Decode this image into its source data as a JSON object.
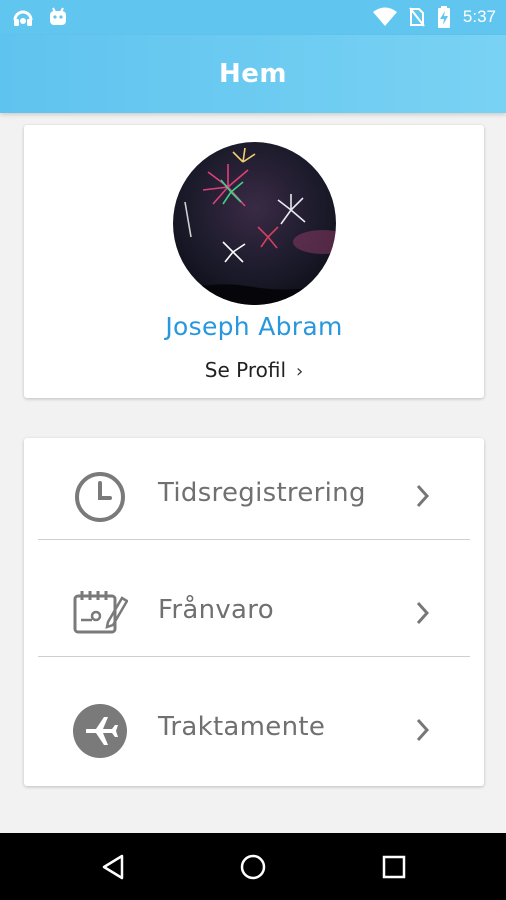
{
  "status_bar": {
    "time": "5:37",
    "icons": [
      "headset-icon",
      "android-icon",
      "wifi-icon",
      "no-sim-icon",
      "battery-charging-icon"
    ]
  },
  "app_bar": {
    "title": "Hem"
  },
  "profile": {
    "name": "Joseph Abram",
    "link_label": "Se Profil"
  },
  "menu": {
    "items": [
      {
        "label": "Tidsregistrering",
        "icon": "clock-icon"
      },
      {
        "label": "Frånvaro",
        "icon": "calendar-edit-icon"
      },
      {
        "label": "Traktamente",
        "icon": "airplane-icon"
      }
    ]
  },
  "nav_bar": {
    "buttons": [
      "back-icon",
      "home-icon",
      "recents-icon"
    ]
  },
  "colors": {
    "primary": "#61c6ef",
    "name_accent": "#2897de",
    "menu_text": "#707070"
  }
}
